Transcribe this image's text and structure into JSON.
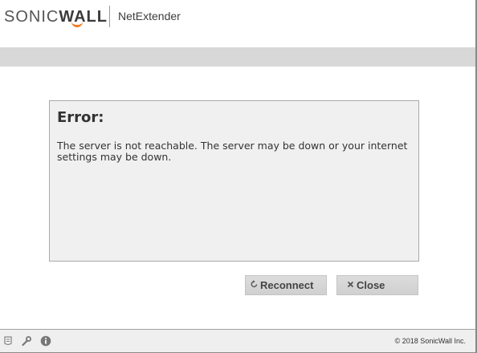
{
  "header": {
    "brand_light": "SONIC",
    "brand_bold": "WALL",
    "product": "NetExtender"
  },
  "error": {
    "title": "Error:",
    "message": "The server is not reachable. The server may be down or your internet settings may be down."
  },
  "buttons": {
    "reconnect_label": "Reconnect",
    "reconnect_icon": "refresh-icon",
    "close_label": "Close",
    "close_icon": "close-icon"
  },
  "footer": {
    "icons": [
      "log-icon",
      "wrench-icon",
      "info-icon"
    ],
    "copyright": "© 2018 SonicWall Inc."
  },
  "colors": {
    "brand_accent": "#f07c22",
    "panel_bg": "#f0f0f0",
    "bar_gray": "#d8d8d8"
  }
}
